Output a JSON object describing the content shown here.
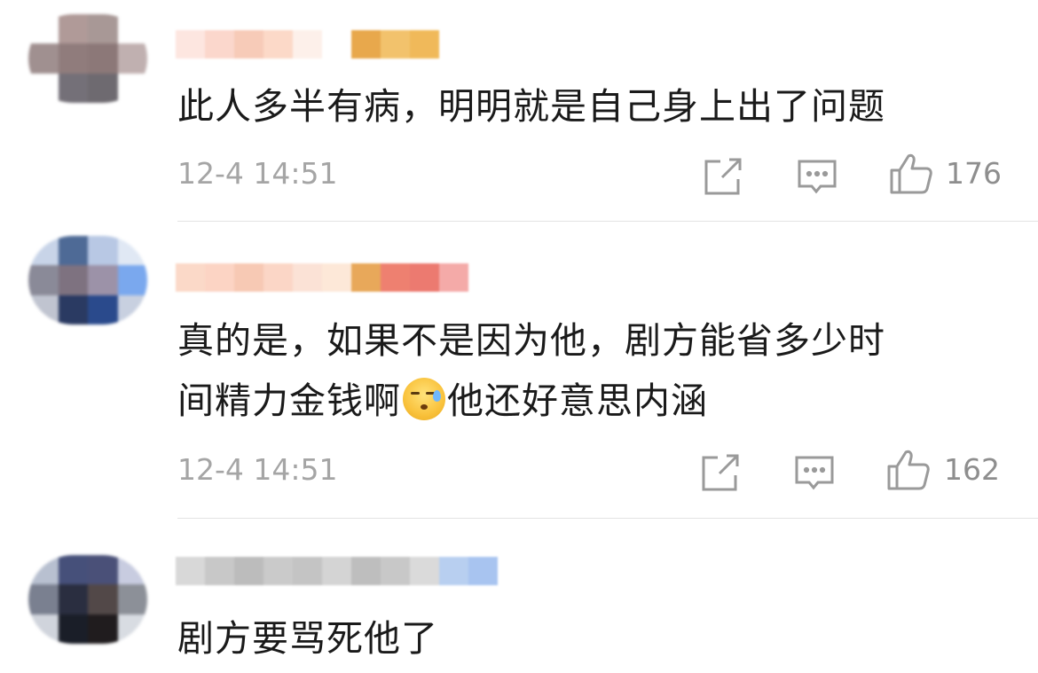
{
  "comments": [
    {
      "text": "此人多半有病，明明就是自己身上出了问题",
      "time": "12-4 14:51",
      "likes": "176",
      "avatar_colors": [
        "#ffffff",
        "#b09a98",
        "#a89896",
        "#ffffff",
        "#a09090",
        "#907c7c",
        "#8c7878",
        "#c0b0b0",
        "#ffffff",
        "#747078",
        "#6e6a70",
        "#ffffff"
      ],
      "name_colors": [
        "#fde6e0",
        "#fbd7cc",
        "#f7cbb8",
        "#fcd9c8",
        "#fdf0ea",
        "#ffffff",
        "#e8a84c",
        "#f2c26c",
        "#f0b95a"
      ]
    },
    {
      "text_line1": "真的是，如果不是因为他，剧方能省多少时",
      "text_line2_before": "间精力金钱啊",
      "text_line2_after": "他还好意思内涵",
      "time": "12-4 14:51",
      "likes": "162",
      "avatar_colors": [
        "#c8d4e8",
        "#4e6a96",
        "#b8c8e4",
        "#e0e8f4",
        "#8a8a98",
        "#7e7280",
        "#9c92a8",
        "#7aa8ee",
        "#c0c4d0",
        "#2a3a62",
        "#2a4a8c",
        "#c8d0e0"
      ],
      "name_colors": [
        "#fbd9c8",
        "#fcd4c4",
        "#f7c9b4",
        "#fbd6c6",
        "#fbe2d6",
        "#fde8d8",
        "#e8a85a",
        "#ee8070",
        "#ec7a70",
        "#f4aaa8"
      ]
    },
    {
      "text": "剧方要骂死他了",
      "avatar_colors": [
        "#b8c0d0",
        "#46507a",
        "#4a5078",
        "#c8cce0",
        "#7a8090",
        "#2a2e40",
        "#524848",
        "#8c9098",
        "#d0d4dc",
        "#1a1e28",
        "#201c1e",
        "#d8dce2"
      ],
      "name_colors": [
        "#d8d8d8",
        "#c8c8c8",
        "#bcbcbc",
        "#cacaca",
        "#c4c4c4",
        "#d4d4d4",
        "#bebebe",
        "#c8c8c8",
        "#dadada",
        "#b8cff0",
        "#a8c4f0"
      ]
    }
  ],
  "icons": {
    "share": "share-icon",
    "reply": "comment-icon",
    "like": "thumbs-up-icon"
  },
  "colors": {
    "time_text": "#a5a5a5",
    "icon_stroke": "#9a9a9a",
    "divider": "#e4e4e4"
  }
}
